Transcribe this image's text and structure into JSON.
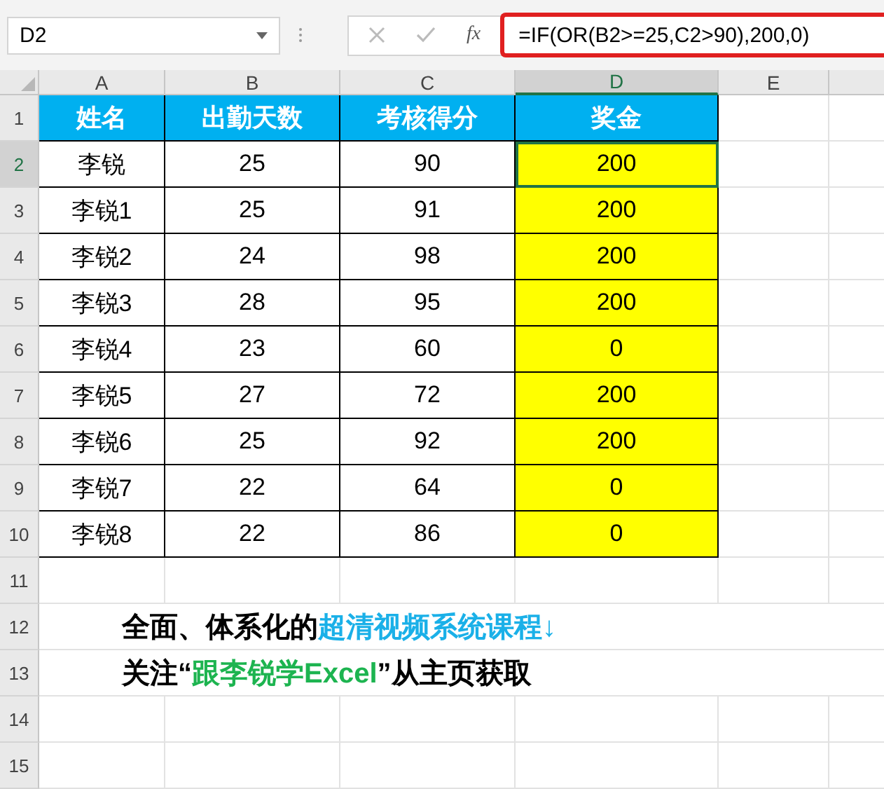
{
  "formula_bar": {
    "name_box": "D2",
    "function_label": "fx",
    "formula": "=IF(OR(B2>=25,C2>90),200,0)",
    "formula_highlighted": true
  },
  "columns": [
    {
      "label": "A",
      "selected": false,
      "filled": false
    },
    {
      "label": "B",
      "selected": false,
      "filled": false
    },
    {
      "label": "C",
      "selected": false,
      "filled": false
    },
    {
      "label": "D",
      "selected": true,
      "filled": true
    },
    {
      "label": "E",
      "selected": false
    }
  ],
  "header_row": {
    "number": "1",
    "cells": [
      "姓名",
      "出勤天数",
      "考核得分",
      "奖金"
    ]
  },
  "rows": [
    {
      "number": "2",
      "selected": true,
      "cells": [
        "李锐",
        "25",
        "90",
        "200"
      ]
    },
    {
      "number": "3",
      "selected": false,
      "cells": [
        "李锐1",
        "25",
        "91",
        "200"
      ]
    },
    {
      "number": "4",
      "selected": false,
      "cells": [
        "李锐2",
        "24",
        "98",
        "200"
      ]
    },
    {
      "number": "5",
      "selected": false,
      "cells": [
        "李锐3",
        "28",
        "95",
        "200"
      ]
    },
    {
      "number": "6",
      "selected": false,
      "cells": [
        "李锐4",
        "23",
        "60",
        "0"
      ]
    },
    {
      "number": "7",
      "selected": false,
      "cells": [
        "李锐5",
        "27",
        "72",
        "200"
      ]
    },
    {
      "number": "8",
      "selected": false,
      "cells": [
        "李锐6",
        "25",
        "92",
        "200"
      ]
    },
    {
      "number": "9",
      "selected": false,
      "cells": [
        "李锐7",
        "22",
        "64",
        "0"
      ]
    },
    {
      "number": "10",
      "selected": false,
      "cells": [
        "李锐8",
        "22",
        "86",
        "0"
      ]
    }
  ],
  "empty_rows": [
    {
      "number": "11",
      "segments": []
    },
    {
      "number": "12",
      "segments": [
        {
          "text": "全面、体系化的",
          "color": "#000000"
        },
        {
          "text": "超清视频系统课程↓",
          "color": "#1ab0e8"
        }
      ]
    },
    {
      "number": "13",
      "segments": [
        {
          "text": "关注“",
          "color": "#000000"
        },
        {
          "text": "跟李锐学Excel",
          "color": "#1db450"
        },
        {
          "text": "”从主页获取",
          "color": "#000000"
        }
      ]
    },
    {
      "number": "14",
      "segments": []
    },
    {
      "number": "15",
      "segments": []
    }
  ]
}
